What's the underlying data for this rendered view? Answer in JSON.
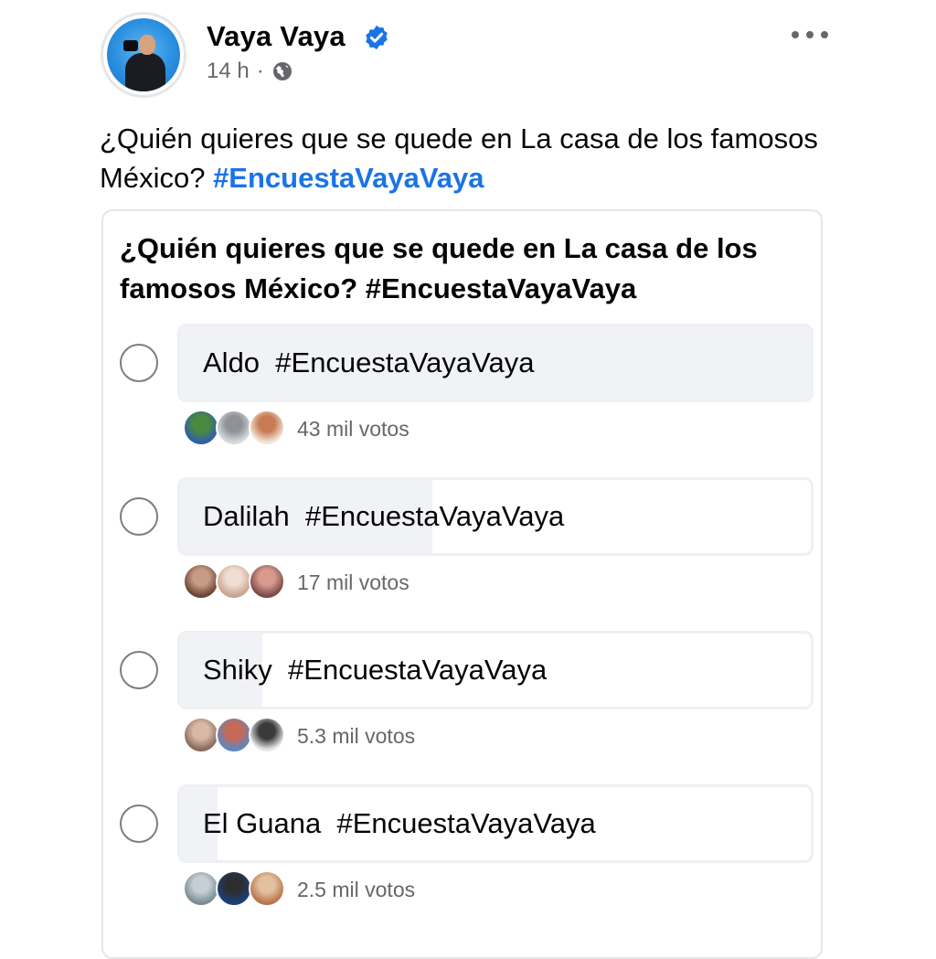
{
  "post": {
    "author": "Vaya Vaya",
    "time": "14 h",
    "separator": "·",
    "text": "¿Quién quieres que se quede en La casa de los famosos México?",
    "hashtag": "#EncuestaVayaVaya"
  },
  "icons": {
    "verified": "verified-badge-icon",
    "audience": "globe-icon",
    "more": "more-options-icon",
    "radio": "radio-button-icon"
  },
  "colors": {
    "accent": "#1b74e4",
    "muted_text": "#65676b",
    "bar_fill": "#f0f2f5"
  },
  "poll": {
    "question": "¿Quién quieres que se quede en La casa de los famosos México? #EncuestaVayaVaya",
    "options": [
      {
        "label": "Aldo  #EncuestaVayaVaya",
        "votes": "43 mil votos",
        "share": 1.0,
        "voter_colors": [
          [
            "#2e5fa8",
            "#4b8a3e"
          ],
          [
            "#d7dadf",
            "#8e9297"
          ],
          [
            "#f2e6d9",
            "#c77b52"
          ]
        ]
      },
      {
        "label": "Dalilah  #EncuestaVayaVaya",
        "votes": "17 mil votos",
        "share": 0.4,
        "voter_colors": [
          [
            "#6b4535",
            "#c89b86"
          ],
          [
            "#c9a38f",
            "#f0ddd2"
          ],
          [
            "#7a4a48",
            "#d99a8e"
          ]
        ]
      },
      {
        "label": "Shiky  #EncuestaVayaVaya",
        "votes": "5.3 mil votos",
        "share": 0.13,
        "voter_colors": [
          [
            "#8a6a5a",
            "#d9b9a6"
          ],
          [
            "#5b87c4",
            "#c46a55"
          ],
          [
            "#e6e6e6",
            "#3a3a3a"
          ]
        ]
      },
      {
        "label": "El Guana  #EncuestaVayaVaya",
        "votes": "2.5 mil votos",
        "share": 0.06,
        "voter_colors": [
          [
            "#7c8c96",
            "#c5ced4"
          ],
          [
            "#1c3f7a",
            "#2d2d2d"
          ],
          [
            "#b9754a",
            "#e2c0a0"
          ]
        ]
      }
    ]
  }
}
